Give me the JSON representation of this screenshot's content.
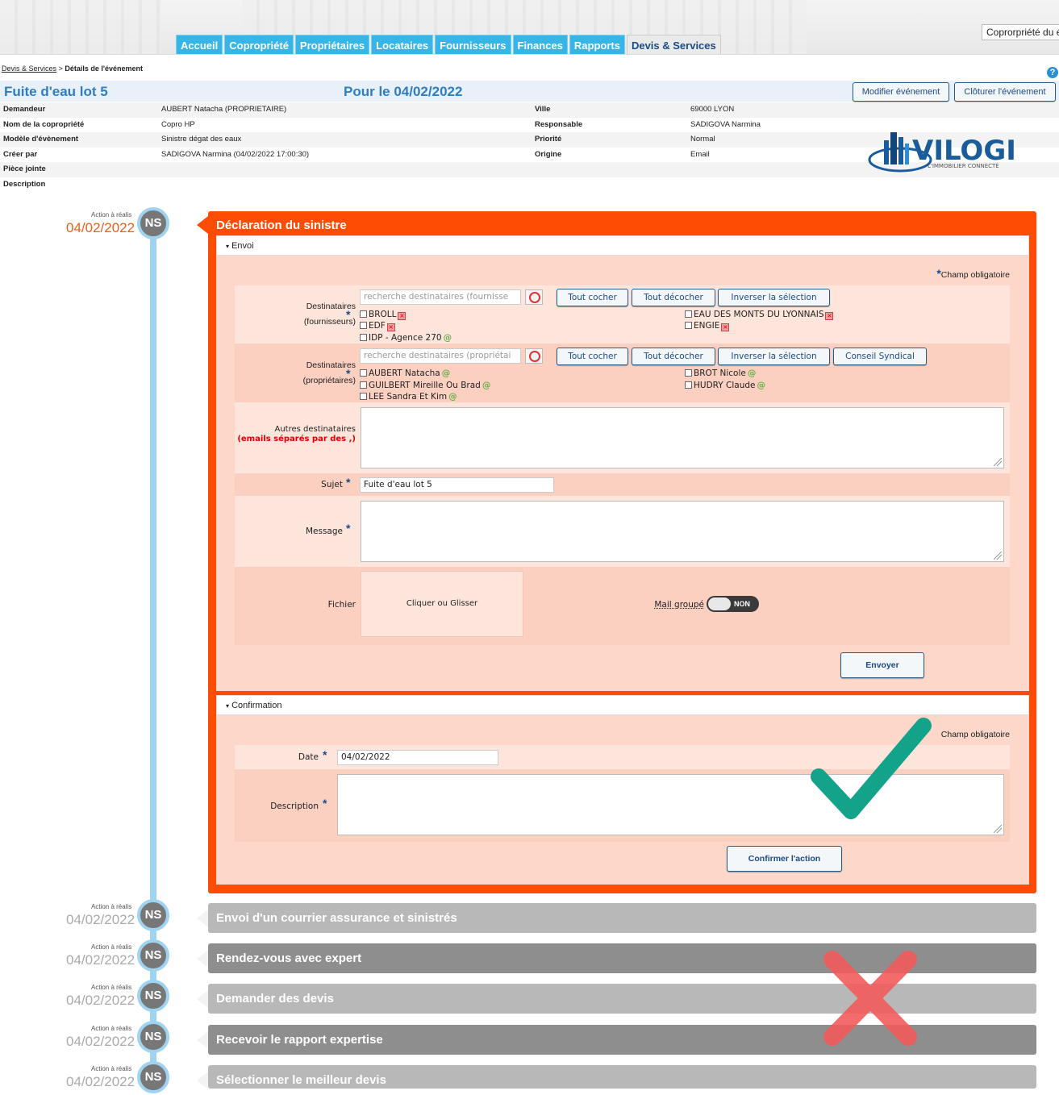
{
  "nav": {
    "tabs": [
      "Accueil",
      "Copropriété",
      "Propriétaires",
      "Locataires",
      "Fournisseurs",
      "Finances",
      "Rapports",
      "Devis & Services"
    ],
    "active": "Devis & Services",
    "copro_select": "Coprorpriété du é"
  },
  "breadcrumb": {
    "link": "Devis & Services",
    "sep": ">",
    "current": "Détails de l'événement"
  },
  "event": {
    "title": "Fuite d'eau lot 5",
    "due": "Pour le 04/02/2022",
    "modify_label": "Modifier événement",
    "close_label": "Clôturer l'événement"
  },
  "info": {
    "rows": [
      {
        "l1": "Demandeur",
        "v1": "AUBERT Natacha (PROPRIETAIRE)",
        "l2": "Ville",
        "v2": "69000 LYON"
      },
      {
        "l1": "Nom de la copropriété",
        "v1": "Copro HP",
        "l2": "Responsable",
        "v2": "SADIGOVA Narmina"
      },
      {
        "l1": "Modèle d'évènement",
        "v1": "Sinistre dégat des eaux",
        "l2": "Priorité",
        "v2": "Normal"
      },
      {
        "l1": "Créer par",
        "v1": "SADIGOVA Narmina (04/02/2022 17:00:30)",
        "l2": "Origine",
        "v2": "Email"
      },
      {
        "l1": "Pièce jointe",
        "v1": "",
        "l2": "",
        "v2": ""
      },
      {
        "l1": "Description",
        "v1": "",
        "l2": "",
        "v2": ""
      }
    ]
  },
  "logo": {
    "name": "VILOGI",
    "tagline": "L'IMMOBILIER CONNECTÉ"
  },
  "timeline": {
    "action_label": "Action à réalis",
    "badge": "NS",
    "date": "04/02/2022",
    "steps": [
      {
        "title": "Déclaration du sinistre"
      },
      {
        "title": "Envoi d'un courrier assurance et sinistrés"
      },
      {
        "title": "Rendez-vous avec expert"
      },
      {
        "title": "Demander des devis"
      },
      {
        "title": "Recevoir le rapport expertise"
      },
      {
        "title": "Sélectionner le meilleur devis"
      }
    ]
  },
  "envoi": {
    "section": "Envoi",
    "champ": "Champ obligatoire",
    "dest_fournisseurs_label": "Destinataires",
    "dest_fournisseurs_sub": "(fournisseurs)",
    "search_fournisseurs": "recherche destinataires (fournisse",
    "tout_cocher": "Tout cocher",
    "tout_decocher": "Tout décocher",
    "inverser": "Inverser la sélection",
    "conseil": "Conseil Syndical",
    "fournisseurs": [
      "BROLL",
      "EDF",
      "IDP - Agence 270",
      "EAU DES MONTS DU LYONNAIS",
      "ENGIE"
    ],
    "dest_proprietaires_label": "Destinataires",
    "dest_proprietaires_sub": "(propriétaires)",
    "search_proprietaires": "recherche destinataires (propriétai",
    "proprietaires": [
      "AUBERT Natacha",
      "GUILBERT Mireille Ou Brad",
      "LEE Sandra Et Kim",
      "BROT Nicole",
      "HUDRY Claude"
    ],
    "autres_label": "Autres destinataires",
    "autres_hint": "(emails séparés par des ,)",
    "sujet_label": "Sujet",
    "sujet_value": "Fuite d'eau lot 5",
    "message_label": "Message",
    "fichier_label": "Fichier",
    "dropzone": "Cliquer ou Glisser",
    "mail_groupe": "Mail groupé",
    "toggle": "NON",
    "send": "Envoyer"
  },
  "confirmation": {
    "section": "Confirmation",
    "champ": "Champ obligatoire",
    "date_label": "Date",
    "date_value": "04/02/2022",
    "description_label": "Description",
    "confirm": "Confirmer l'action"
  },
  "colors": {
    "active_card": "#fd4d04",
    "nav_tab": "#37b5e6",
    "title": "#2e7dc1",
    "timeline": "#9fd3f2"
  }
}
